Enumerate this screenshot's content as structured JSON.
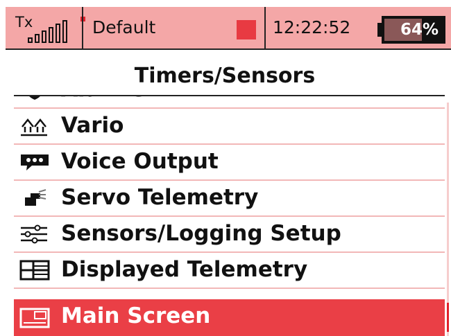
{
  "status_bar": {
    "tx_label": "Tx",
    "signal_icon": "signal-strength-icon",
    "profile_name": "Default",
    "record_indicator_color": "#e83a42",
    "clock": "12:22:52",
    "battery": {
      "percent_label": "64%",
      "level": 0.64
    }
  },
  "page": {
    "title": "Timers/Sensors"
  },
  "menu": {
    "items": [
      {
        "label": "Alarms",
        "icon": "alarm-shield-icon"
      },
      {
        "label": "Vario",
        "icon": "vario-arrows-icon"
      },
      {
        "label": "Voice Output",
        "icon": "speech-bubble-icon"
      },
      {
        "label": "Servo Telemetry",
        "icon": "servo-icon"
      },
      {
        "label": "Sensors/Logging Setup",
        "icon": "sliders-icon"
      },
      {
        "label": "Displayed Telemetry",
        "icon": "telemetry-grid-icon"
      },
      {
        "label": "Main Screen",
        "icon": "main-screen-icon",
        "selected": true
      }
    ]
  },
  "colors": {
    "accent": "#ea3f46",
    "status_bar_bg": "#f4a7a7",
    "divider": "#f2b7b7"
  }
}
